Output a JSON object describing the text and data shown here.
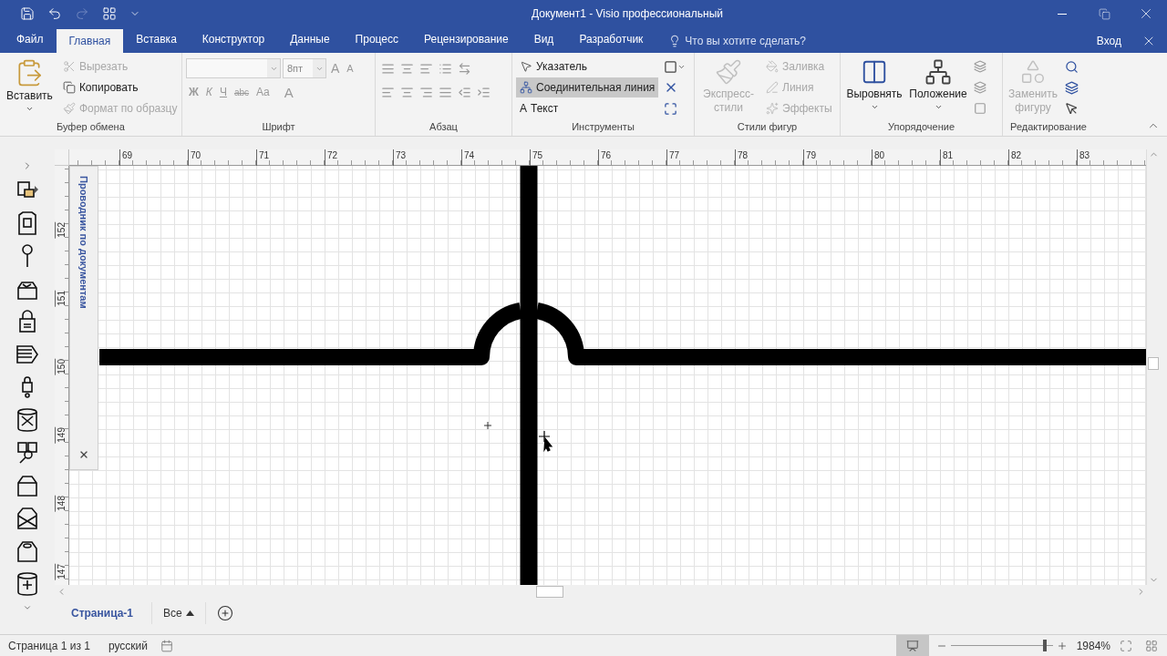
{
  "window": {
    "title": "Документ1 - Visio профессиональный"
  },
  "tabs": [
    {
      "label": "Файл",
      "selected": false
    },
    {
      "label": "Главная",
      "selected": true
    },
    {
      "label": "Вставка",
      "selected": false
    },
    {
      "label": "Конструктор",
      "selected": false
    },
    {
      "label": "Данные",
      "selected": false
    },
    {
      "label": "Процесс",
      "selected": false
    },
    {
      "label": "Рецензирование",
      "selected": false
    },
    {
      "label": "Вид",
      "selected": false
    },
    {
      "label": "Разработчик",
      "selected": false
    }
  ],
  "tell_me": "Что вы хотите сделать?",
  "sign_in": "Вход",
  "clipboard": {
    "label": "Буфер обмена",
    "paste": "Вставить",
    "items": [
      {
        "kind": "cut",
        "label": "Вырезать",
        "disabled": true
      },
      {
        "kind": "copy",
        "label": "Копировать",
        "disabled": false
      },
      {
        "kind": "format",
        "label": "Формат по образцу",
        "disabled": true
      }
    ]
  },
  "font": {
    "label": "Шрифт",
    "size": "8пт",
    "grow": "A",
    "shrink": "A",
    "styles": [
      {
        "kind": "bold",
        "glyph": "Ж"
      },
      {
        "kind": "italic",
        "glyph": "К"
      },
      {
        "kind": "underline",
        "glyph": "Ч"
      },
      {
        "kind": "strike",
        "glyph": "abc"
      },
      {
        "kind": "case",
        "glyph": "Aa"
      }
    ],
    "color_glyph": "A"
  },
  "paragraph": {
    "label": "Абзац"
  },
  "tools": {
    "label": "Инструменты",
    "items": [
      {
        "kind": "pointer",
        "label": "Указатель",
        "selected": false
      },
      {
        "kind": "connector",
        "label": "Соединительная линия",
        "selected": true
      },
      {
        "kind": "text",
        "glyph": "A",
        "label": "Текст",
        "selected": false
      }
    ]
  },
  "shape_styles": {
    "label": "Стили фигур",
    "quick_styles": {
      "label": "Экспресс-стили",
      "disabled": true
    },
    "items": [
      {
        "kind": "fill",
        "label": "Заливка",
        "disabled": true
      },
      {
        "kind": "line",
        "label": "Линия",
        "disabled": true
      },
      {
        "kind": "effects",
        "label": "Эффекты",
        "disabled": true
      }
    ]
  },
  "arrange": {
    "label": "Упорядочение",
    "buttons": [
      {
        "kind": "align",
        "label": "Выровнять"
      },
      {
        "kind": "position",
        "label": "Положение"
      }
    ]
  },
  "editing": {
    "label": "Редактирование",
    "replace": {
      "label": "Заменить фигуру",
      "disabled": true
    }
  },
  "rulers": {
    "horizontal": [
      "69",
      "70",
      "71",
      "72",
      "73",
      "74",
      "75",
      "76",
      "77",
      "78",
      "79",
      "80",
      "81",
      "82",
      "83"
    ],
    "vertical": [
      "152",
      "151",
      "150",
      "149",
      "148",
      "147"
    ]
  },
  "document_explorer": {
    "title": "Проводник по документам"
  },
  "page_tabs": [
    {
      "label": "Страница-1",
      "selected": true
    }
  ],
  "all_pages": "Все",
  "status_bar": {
    "page": "Страница 1 из 1",
    "language": "русский",
    "zoom": {
      "level": 0.94,
      "reading": "1984%"
    }
  }
}
